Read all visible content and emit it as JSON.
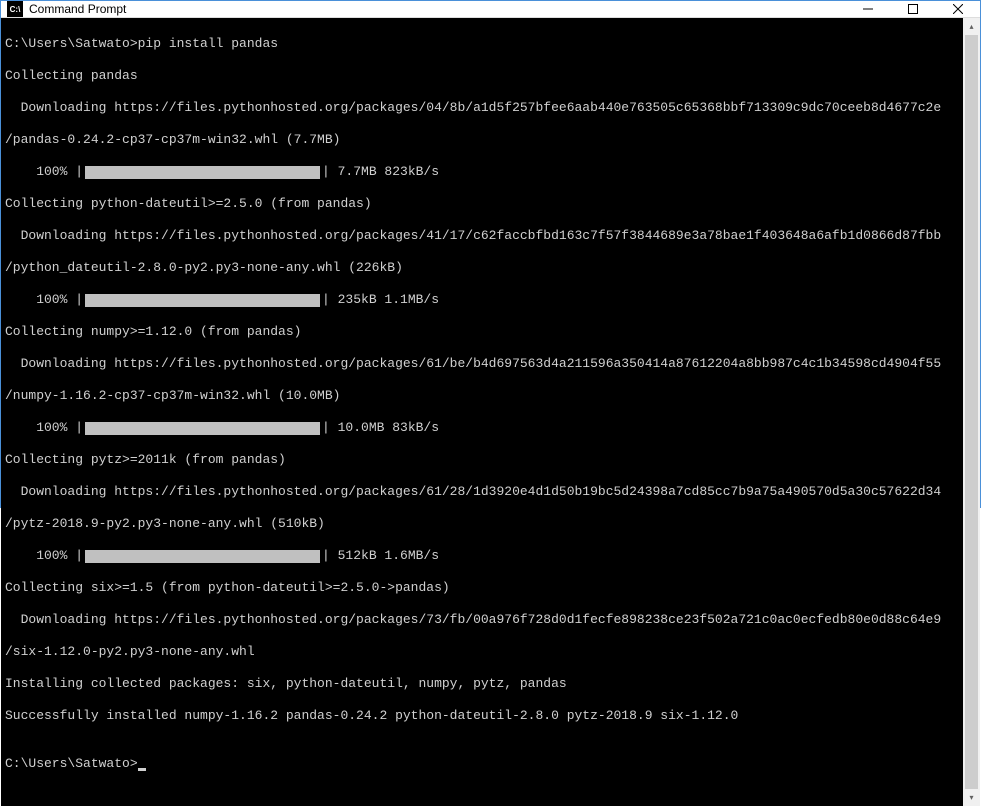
{
  "window": {
    "title": "Command Prompt",
    "icon_text": "C:\\"
  },
  "prompt": {
    "path": "C:\\Users\\Satwato>",
    "command": "pip install pandas"
  },
  "lines": {
    "collect_pandas": "Collecting pandas",
    "dl_pandas_url": "  Downloading https://files.pythonhosted.org/packages/04/8b/a1d5f257bfee6aab440e763505c65368bbf713309c9dc70ceeb8d4677c2e",
    "dl_pandas_whl": "/pandas-0.24.2-cp37-cp37m-win32.whl (7.7MB)",
    "collect_dateutil": "Collecting python-dateutil>=2.5.0 (from pandas)",
    "dl_dateutil_url": "  Downloading https://files.pythonhosted.org/packages/41/17/c62faccbfbd163c7f57f3844689e3a78bae1f403648a6afb1d0866d87fbb",
    "dl_dateutil_whl": "/python_dateutil-2.8.0-py2.py3-none-any.whl (226kB)",
    "collect_numpy": "Collecting numpy>=1.12.0 (from pandas)",
    "dl_numpy_url": "  Downloading https://files.pythonhosted.org/packages/61/be/b4d697563d4a211596a350414a87612204a8bb987c4c1b34598cd4904f55",
    "dl_numpy_whl": "/numpy-1.16.2-cp37-cp37m-win32.whl (10.0MB)",
    "collect_pytz": "Collecting pytz>=2011k (from pandas)",
    "dl_pytz_url": "  Downloading https://files.pythonhosted.org/packages/61/28/1d3920e4d1d50b19bc5d24398a7cd85cc7b9a75a490570d5a30c57622d34",
    "dl_pytz_whl": "/pytz-2018.9-py2.py3-none-any.whl (510kB)",
    "collect_six": "Collecting six>=1.5 (from python-dateutil>=2.5.0->pandas)",
    "dl_six_url": "  Downloading https://files.pythonhosted.org/packages/73/fb/00a976f728d0d1fecfe898238ce23f502a721c0ac0ecfedb80e0d88c64e9",
    "dl_six_whl": "/six-1.12.0-py2.py3-none-any.whl",
    "installing": "Installing collected packages: six, python-dateutil, numpy, pytz, pandas",
    "success": "Successfully installed numpy-1.16.2 pandas-0.24.2 python-dateutil-2.8.0 pytz-2018.9 six-1.12.0",
    "blank": ""
  },
  "progress": {
    "pandas": {
      "pre": "    100% |",
      "post": "| 7.7MB 823kB/s"
    },
    "dateutil": {
      "pre": "    100% |",
      "post": "| 235kB 1.1MB/s"
    },
    "numpy": {
      "pre": "    100% |",
      "post": "| 10.0MB 83kB/s"
    },
    "pytz": {
      "pre": "    100% |",
      "post": "| 512kB 1.6MB/s"
    }
  }
}
